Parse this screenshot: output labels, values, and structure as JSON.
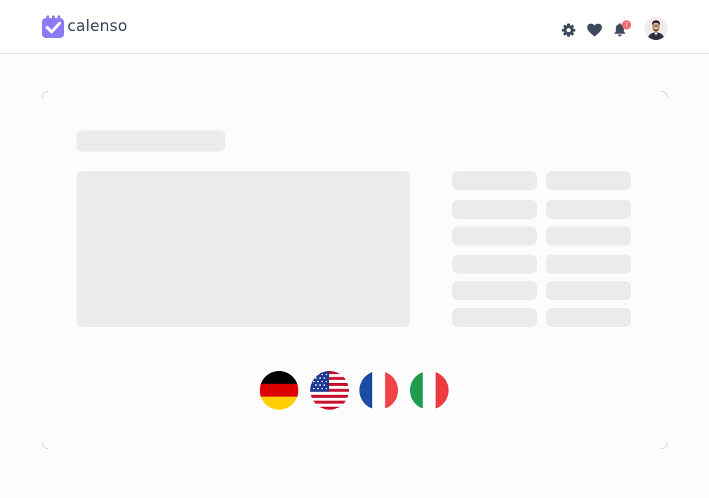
{
  "brand": {
    "name": "calenso",
    "accent": "#8b7cf6",
    "text_color": "#3d4a5c"
  },
  "header": {
    "icons": [
      "gear-icon",
      "heart-icon",
      "bell-icon"
    ],
    "notification_count": "7",
    "badge_color": "#ef6b6b",
    "avatar": "user-avatar"
  },
  "skeleton": {
    "color": "#ebebeb",
    "title_placeholder": 1,
    "main_block": 1,
    "slot_rows": 6,
    "slot_columns": 2
  },
  "languages": [
    {
      "code": "de",
      "icon": "germany-flag-icon"
    },
    {
      "code": "en-us",
      "icon": "usa-flag-icon"
    },
    {
      "code": "fr",
      "icon": "france-flag-icon"
    },
    {
      "code": "it",
      "icon": "italy-flag-icon"
    }
  ]
}
